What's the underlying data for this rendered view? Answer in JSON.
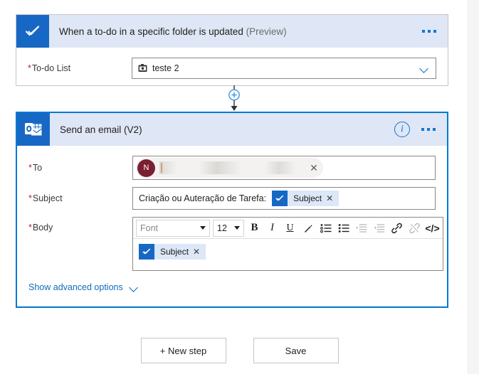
{
  "trigger_card": {
    "icon": "microsoft-todo-icon",
    "title": "When a to-do in a specific folder is updated",
    "preview_tag": "(Preview)",
    "menu_icon": "ellipsis-icon",
    "fields": [
      {
        "label": "To-do List",
        "required_marker": "*",
        "value": "teste 2",
        "value_icon": "todo-list-icon",
        "dropdown_icon": "chevron-down-icon"
      }
    ]
  },
  "connector": {
    "add_icon": "plus-circle-icon",
    "arrow_icon": "arrow-down-icon"
  },
  "action_card": {
    "icon": "outlook-icon",
    "title": "Send an email (V2)",
    "info_icon": "info-circle-icon",
    "menu_icon": "ellipsis-icon",
    "to_field": {
      "label": "To",
      "required_marker": "*",
      "recipient_initial": "N",
      "recipient_value": "",
      "avatar_color": "#7b1f32",
      "remove_icon": "close-icon"
    },
    "subject_field": {
      "label": "Subject",
      "required_marker": "*",
      "text": "Criação ou Auteração de Tarefa:",
      "token": {
        "label": "Subject",
        "icon": "microsoft-todo-icon",
        "remove_icon": "close-icon"
      }
    },
    "body_field": {
      "label": "Body",
      "required_marker": "*",
      "toolbar": {
        "font_placeholder": "Font",
        "font_size": "12",
        "buttons": [
          {
            "name": "bold-icon",
            "glyph": "B",
            "enabled": true
          },
          {
            "name": "italic-icon",
            "glyph": "I",
            "enabled": true
          },
          {
            "name": "underline-icon",
            "glyph": "U",
            "enabled": true
          },
          {
            "name": "text-color-icon",
            "glyph": "pen",
            "enabled": true
          },
          {
            "name": "bulleted-list-icon",
            "glyph": "ul",
            "enabled": true
          },
          {
            "name": "numbered-list-icon",
            "glyph": "ol",
            "enabled": true
          },
          {
            "name": "indent-increase-icon",
            "glyph": "in",
            "enabled": false
          },
          {
            "name": "indent-decrease-icon",
            "glyph": "out",
            "enabled": false
          },
          {
            "name": "link-icon",
            "glyph": "link",
            "enabled": true
          },
          {
            "name": "unlink-icon",
            "glyph": "unlink",
            "enabled": false
          },
          {
            "name": "code-view-icon",
            "glyph": "</>",
            "enabled": true
          }
        ]
      },
      "token": {
        "label": "Subject",
        "icon": "microsoft-todo-icon",
        "remove_icon": "close-icon"
      }
    },
    "advanced_options": {
      "label": "Show advanced options",
      "chevron_icon": "chevron-down-icon"
    }
  },
  "footer": {
    "new_step_label": "+ New step",
    "save_label": "Save"
  },
  "colors": {
    "accent_blue": "#0078d4",
    "icon_blue": "#1768c5",
    "header_blue": "#dfe6f5",
    "required_red": "#a4262c",
    "token_blue": "#dce7f7"
  }
}
